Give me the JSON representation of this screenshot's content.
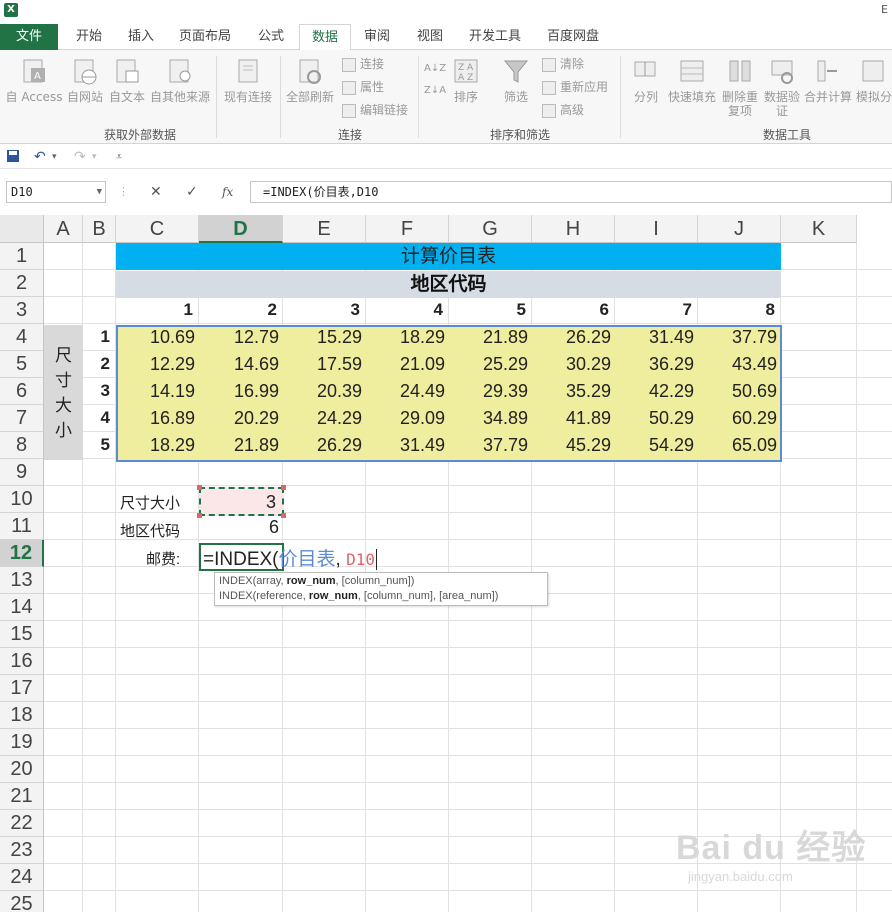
{
  "app": {
    "logo": "X",
    "title_fragment": "E"
  },
  "tabs": [
    {
      "label": "文件",
      "kind": "file"
    },
    {
      "label": "开始"
    },
    {
      "label": "插入"
    },
    {
      "label": "页面布局"
    },
    {
      "label": "公式"
    },
    {
      "label": "数据",
      "kind": "active"
    },
    {
      "label": "审阅"
    },
    {
      "label": "视图"
    },
    {
      "label": "开发工具"
    },
    {
      "label": "百度网盘"
    }
  ],
  "ribbon": {
    "external": {
      "buttons": [
        "自 Access",
        "自网站",
        "自文本",
        "自其他来源",
        "现有连接"
      ],
      "group_label": "获取外部数据"
    },
    "connections": {
      "refresh_all": "全部刷新",
      "items": [
        "连接",
        "属性",
        "编辑链接"
      ],
      "group_label": "连接"
    },
    "sort_filter": {
      "sort": "排序",
      "filter": "筛选",
      "items": [
        "清除",
        "重新应用",
        "高级"
      ],
      "group_label": "排序和筛选"
    },
    "tools": {
      "buttons": [
        "分列",
        "快速填充",
        "删除重复项",
        "数据验证",
        "合并计算",
        "模拟分"
      ],
      "group_label": "数据工具"
    }
  },
  "namebox": "D10",
  "formula": "=INDEX(价目表,D10",
  "columns": [
    "A",
    "B",
    "C",
    "D",
    "E",
    "F",
    "G",
    "H",
    "I",
    "J",
    "K"
  ],
  "selected_column": "D",
  "rows": [
    "1",
    "2",
    "3",
    "4",
    "5",
    "6",
    "7",
    "8",
    "9",
    "10",
    "11",
    "12",
    "13",
    "14",
    "15",
    "16",
    "17",
    "18",
    "19",
    "20",
    "21",
    "22",
    "23",
    "24",
    "25"
  ],
  "selected_row": "12",
  "sheet": {
    "title": "计算价目表",
    "region_header": "地区代码",
    "col_numbers": [
      "1",
      "2",
      "3",
      "4",
      "5",
      "6",
      "7",
      "8"
    ],
    "size_label": "尺寸大小",
    "row_numbers": [
      "1",
      "2",
      "3",
      "4",
      "5"
    ],
    "table": [
      [
        "10.69",
        "12.79",
        "15.29",
        "18.29",
        "21.89",
        "26.29",
        "31.49",
        "37.79"
      ],
      [
        "12.29",
        "14.69",
        "17.59",
        "21.09",
        "25.29",
        "30.29",
        "36.29",
        "43.49"
      ],
      [
        "14.19",
        "16.99",
        "20.39",
        "24.49",
        "29.39",
        "35.29",
        "42.29",
        "50.69"
      ],
      [
        "16.89",
        "20.29",
        "24.29",
        "29.09",
        "34.89",
        "41.89",
        "50.29",
        "60.29"
      ],
      [
        "18.29",
        "21.89",
        "26.29",
        "31.49",
        "37.79",
        "45.29",
        "54.29",
        "65.09"
      ]
    ],
    "size_input_label": "尺寸大小",
    "size_input_value": "3",
    "region_input_label": "地区代码",
    "region_input_value": "6",
    "postage_label": "邮费:",
    "editing": {
      "prefix": "=INDEX(",
      "ref_name": "价目表",
      "comma": ", ",
      "ref_cell": "D10"
    }
  },
  "tooltip": {
    "line1": {
      "fn": "INDEX(array, ",
      "bold": "row_num",
      "rest": ", [column_num])"
    },
    "line2": {
      "fn": "INDEX(reference, ",
      "bold": "row_num",
      "rest": ", [column_num], [area_num])"
    }
  },
  "watermark": {
    "brand": "Bai du 经验",
    "url": "jingyan.baidu.com"
  },
  "colors": {
    "accent": "#217346",
    "title_bar": "#00b0f0",
    "table_fill": "#eeee9e",
    "ref_blue": "#5b8bd6",
    "ref_red": "#e06666"
  }
}
